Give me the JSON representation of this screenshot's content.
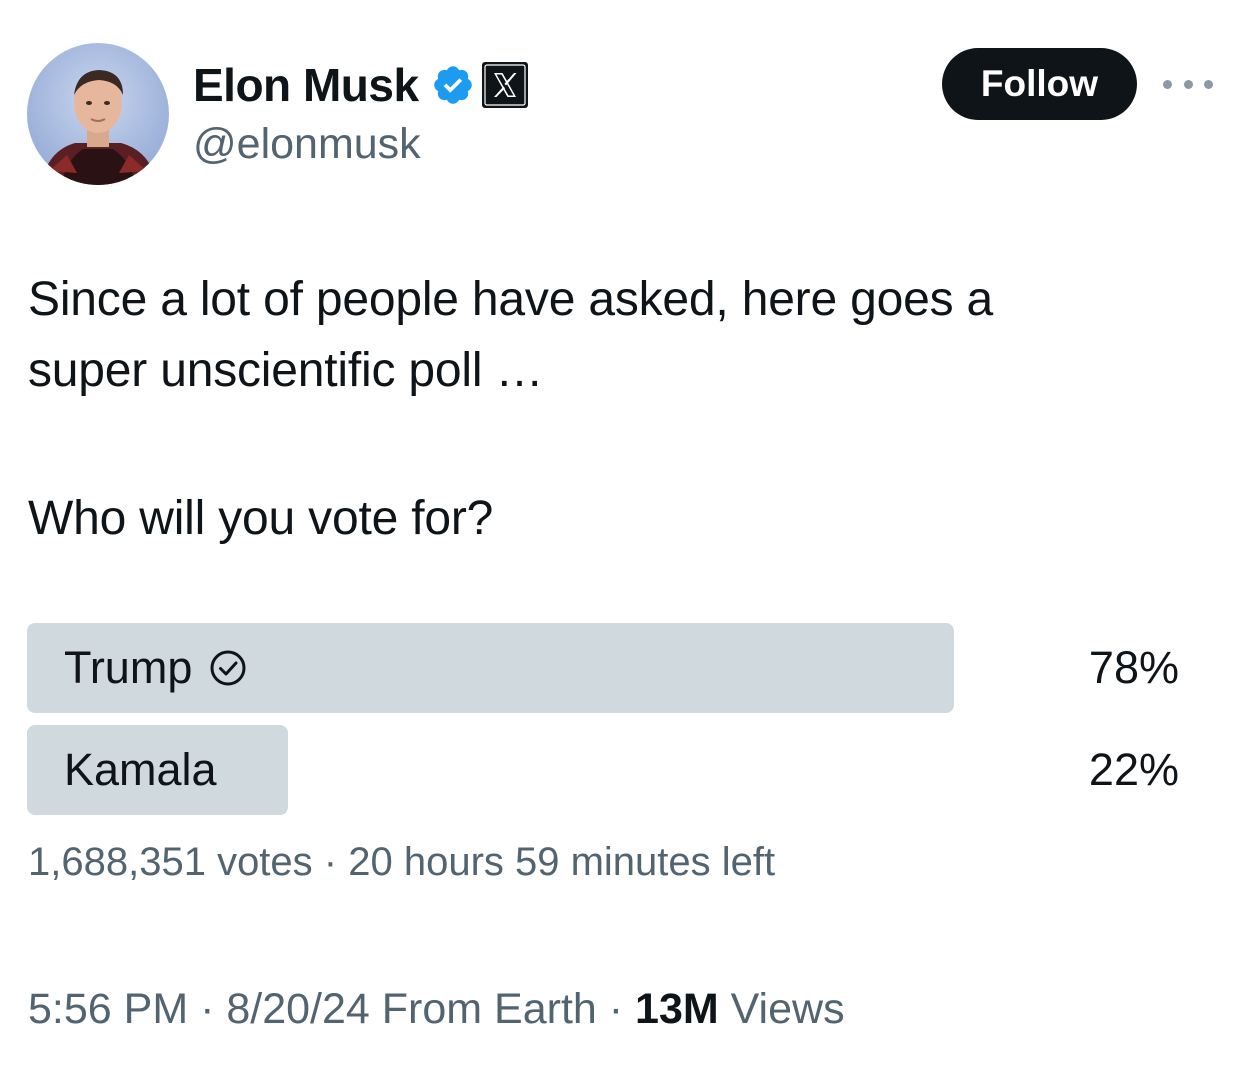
{
  "author": {
    "display_name": "Elon Musk",
    "handle": "@elonmusk",
    "verified_icon": "verified-badge-icon",
    "affiliate_icon": "x-logo-icon"
  },
  "header": {
    "follow_label": "Follow",
    "more_icon": "more-horizontal-icon"
  },
  "tweet": {
    "lines": [
      "Since a lot of people have asked, here goes a",
      "super unscientific poll …",
      "Who will you vote for?"
    ]
  },
  "poll": {
    "options": [
      {
        "label": "Trump",
        "percent_text": "78%",
        "share": 0.78,
        "selected": true
      },
      {
        "label": "Kamala",
        "percent_text": "22%",
        "share": 0.22,
        "selected": false
      }
    ],
    "votes": "1,688,351 votes",
    "separator": " · ",
    "time_left": "20 hours 59 minutes left"
  },
  "footer": {
    "time": "5:56 PM",
    "separator": " · ",
    "date": "8/20/24",
    "source": "From Earth",
    "views_count": "13M",
    "views_label": "Views"
  },
  "colors": {
    "text_primary": "#0f1419",
    "text_secondary": "#536471",
    "verified_blue": "#1d9bf0",
    "poll_fill": "#cfd9de",
    "follow_bg": "#0f1419"
  }
}
